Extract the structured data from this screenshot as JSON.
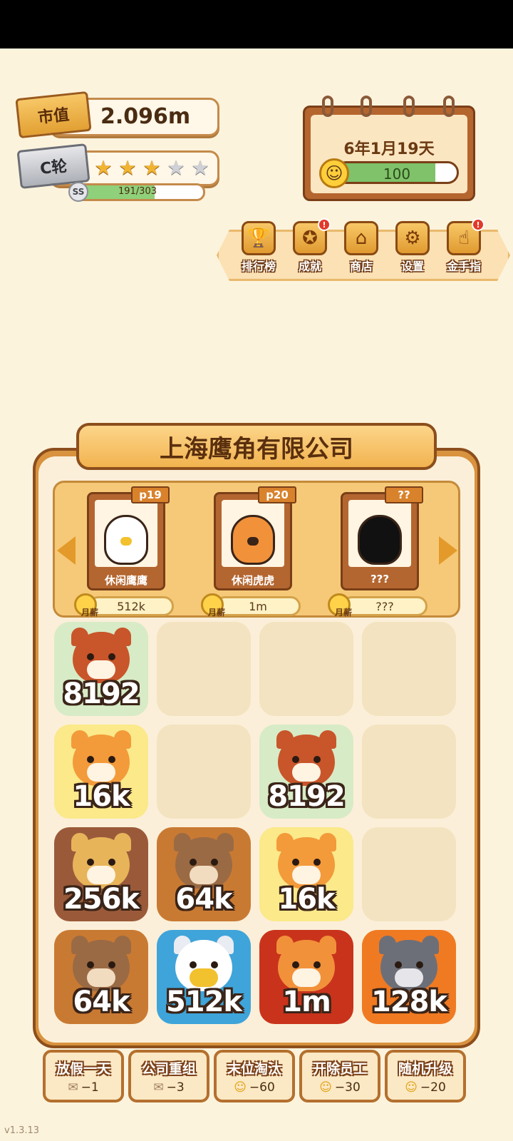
{
  "market_value": {
    "label": "市值",
    "value": "2.096m"
  },
  "funding": {
    "round_label": "C轮",
    "stars_filled": 3,
    "stars_total": 5,
    "grade": "SS",
    "progress_text": "191/303",
    "progress_fraction": 0.63
  },
  "calendar": {
    "date": "6年1月19天",
    "mood_value": "100",
    "mood_fraction": 0.82
  },
  "menu": [
    {
      "label": "排行榜",
      "icon": "trophy-icon",
      "notice": false
    },
    {
      "label": "成就",
      "icon": "medal-icon",
      "notice": true
    },
    {
      "label": "商店",
      "icon": "shop-icon",
      "notice": false
    },
    {
      "label": "设置",
      "icon": "gear-icon",
      "notice": false
    },
    {
      "label": "金手指",
      "icon": "hand-icon",
      "notice": true
    }
  ],
  "company": {
    "name": "上海鹰角有限公司"
  },
  "employees": [
    {
      "level": "p19",
      "name": "休闲鹰鹰",
      "salary": "512k"
    },
    {
      "level": "p20",
      "name": "休闲虎虎",
      "salary": "1m"
    },
    {
      "level": "??",
      "name": "???",
      "salary": "???"
    }
  ],
  "salary_label": "月薪",
  "grid": [
    [
      "8192",
      "",
      "",
      ""
    ],
    [
      "16k",
      "",
      "8192",
      ""
    ],
    [
      "256k",
      "64k",
      "16k",
      ""
    ],
    [
      "64k",
      "512k",
      "1m",
      "128k"
    ]
  ],
  "actions": [
    {
      "label": "放假一天",
      "cost": "−1",
      "cost_icon": "ticket-icon"
    },
    {
      "label": "公司重组",
      "cost": "−3",
      "cost_icon": "ticket-icon"
    },
    {
      "label": "末位淘汰",
      "cost": "−60",
      "cost_icon": "smile-icon"
    },
    {
      "label": "开除员工",
      "cost": "−30",
      "cost_icon": "smile-icon"
    },
    {
      "label": "随机升级",
      "cost": "−20",
      "cost_icon": "smile-icon"
    }
  ],
  "version": "v1.3.13"
}
